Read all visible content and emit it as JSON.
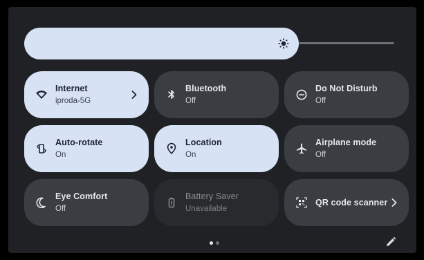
{
  "brightness": {
    "level": 0.74,
    "icon": "brightness-icon"
  },
  "tiles": [
    {
      "label": "Internet",
      "status": "iproda-5G",
      "state": "on",
      "icon": "wifi-icon",
      "has_chevron": true
    },
    {
      "label": "Bluetooth",
      "status": "Off",
      "state": "off",
      "icon": "bluetooth-icon",
      "has_chevron": false
    },
    {
      "label": "Do Not Disturb",
      "status": "Off",
      "state": "off",
      "icon": "do-not-disturb-icon",
      "has_chevron": false
    },
    {
      "label": "Auto-rotate",
      "status": "On",
      "state": "on",
      "icon": "auto-rotate-icon",
      "has_chevron": false
    },
    {
      "label": "Location",
      "status": "On",
      "state": "on",
      "icon": "location-pin-icon",
      "has_chevron": false
    },
    {
      "label": "Airplane mode",
      "status": "Off",
      "state": "off",
      "icon": "airplane-icon",
      "has_chevron": false
    },
    {
      "label": "Eye Comfort",
      "status": "Off",
      "state": "off",
      "icon": "moon-icon",
      "has_chevron": false
    },
    {
      "label": "Battery Saver",
      "status": "Unavailable",
      "state": "unavailable",
      "icon": "battery-icon",
      "has_chevron": false
    },
    {
      "label": "QR code scanner",
      "status": "",
      "state": "off",
      "icon": "qr-code-scan-icon",
      "has_chevron": true
    }
  ],
  "pager": {
    "pages": 2,
    "current": 1
  },
  "colors": {
    "tile_on": "#d7e2f5",
    "tile_off": "#3a3d41",
    "tile_unavailable": "#282a2d",
    "panel_background": "#1f2124"
  },
  "footer": {
    "edit_icon": "pencil-edit-icon"
  }
}
